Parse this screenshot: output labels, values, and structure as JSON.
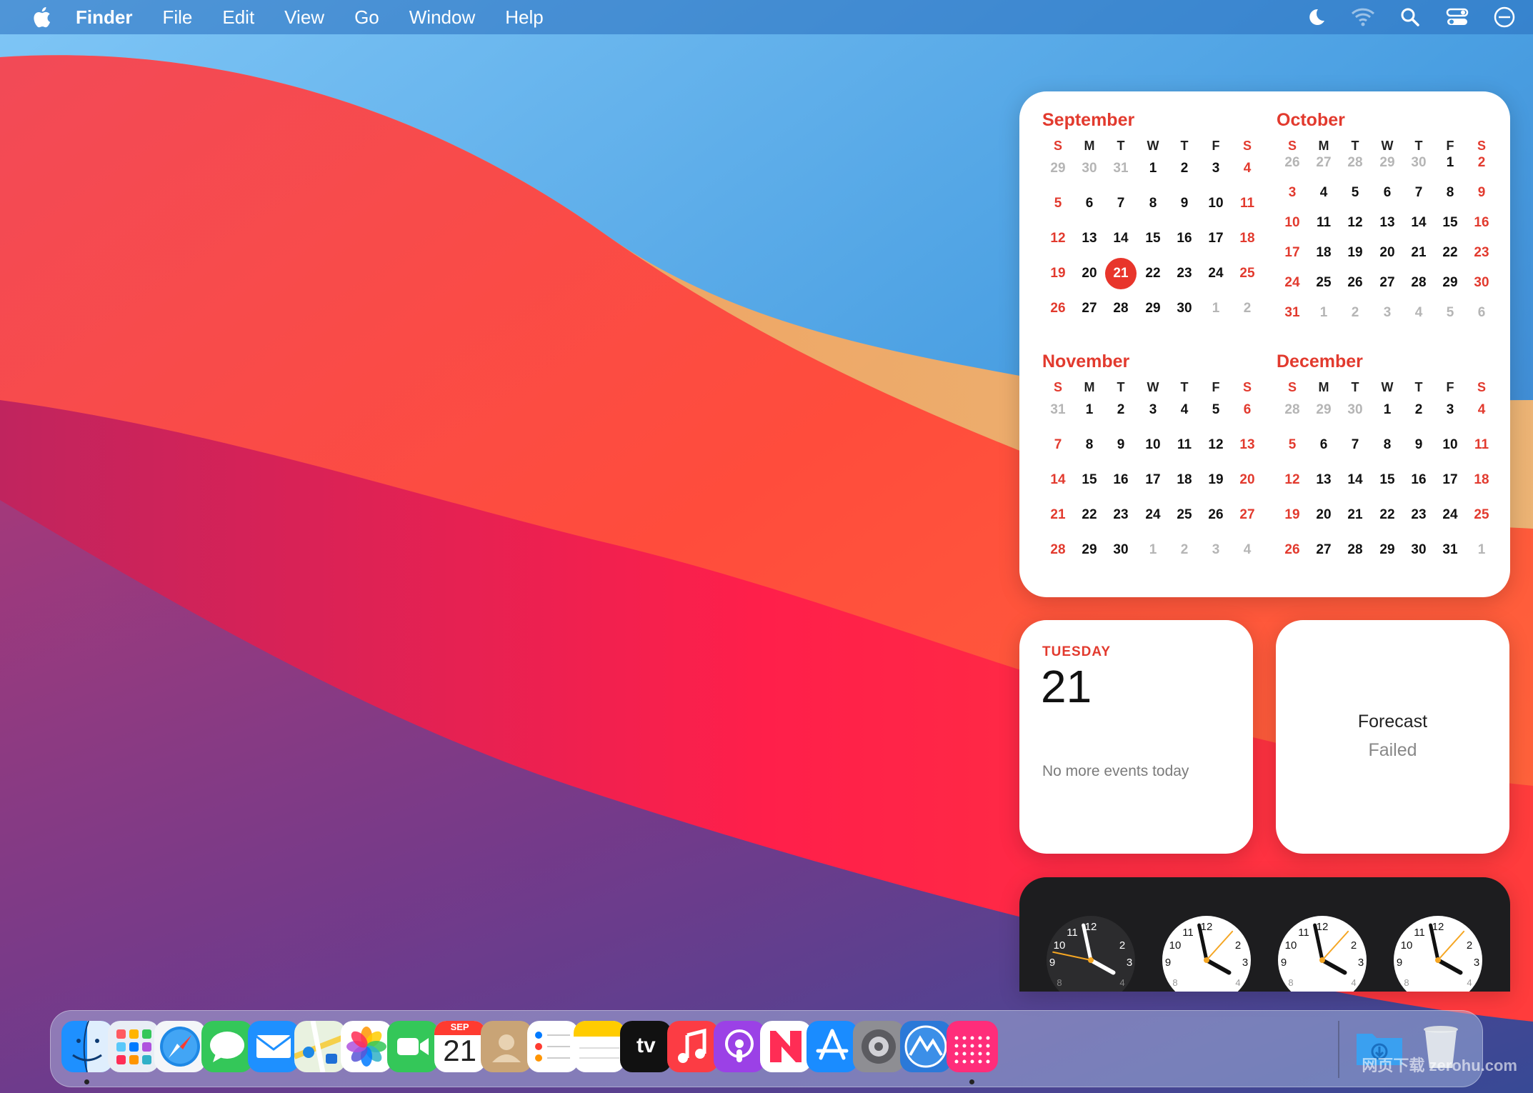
{
  "menubar": {
    "items": [
      {
        "label": "Finder",
        "bold": true
      },
      {
        "label": "File"
      },
      {
        "label": "Edit"
      },
      {
        "label": "View"
      },
      {
        "label": "Go"
      },
      {
        "label": "Window"
      },
      {
        "label": "Help"
      }
    ],
    "status_icons": [
      "moon-icon",
      "wifi-icon",
      "search-icon",
      "control-center-icon",
      "siri-icon"
    ]
  },
  "calendar": {
    "dow": [
      "S",
      "M",
      "T",
      "W",
      "T",
      "F",
      "S"
    ],
    "months": [
      {
        "name": "September",
        "weeks": [
          [
            29,
            30,
            31,
            1,
            2,
            3,
            4
          ],
          [
            5,
            6,
            7,
            8,
            9,
            10,
            11
          ],
          [
            12,
            13,
            14,
            15,
            16,
            17,
            18
          ],
          [
            19,
            20,
            21,
            22,
            23,
            24,
            25
          ],
          [
            26,
            27,
            28,
            29,
            30,
            1,
            2
          ]
        ],
        "leading": 3,
        "trailing": 2,
        "today": 21
      },
      {
        "name": "October",
        "weeks": [
          [
            26,
            27,
            28,
            29,
            30,
            1,
            2
          ],
          [
            3,
            4,
            5,
            6,
            7,
            8,
            9
          ],
          [
            10,
            11,
            12,
            13,
            14,
            15,
            16
          ],
          [
            17,
            18,
            19,
            20,
            21,
            22,
            23
          ],
          [
            24,
            25,
            26,
            27,
            28,
            29,
            30
          ],
          [
            31,
            1,
            2,
            3,
            4,
            5,
            6
          ]
        ],
        "leading": 5,
        "trailing": 6
      },
      {
        "name": "November",
        "weeks": [
          [
            31,
            1,
            2,
            3,
            4,
            5,
            6
          ],
          [
            7,
            8,
            9,
            10,
            11,
            12,
            13
          ],
          [
            14,
            15,
            16,
            17,
            18,
            19,
            20
          ],
          [
            21,
            22,
            23,
            24,
            25,
            26,
            27
          ],
          [
            28,
            29,
            30,
            1,
            2,
            3,
            4
          ]
        ],
        "leading": 1,
        "trailing": 4
      },
      {
        "name": "December",
        "weeks": [
          [
            28,
            29,
            30,
            1,
            2,
            3,
            4
          ],
          [
            5,
            6,
            7,
            8,
            9,
            10,
            11
          ],
          [
            12,
            13,
            14,
            15,
            16,
            17,
            18
          ],
          [
            19,
            20,
            21,
            22,
            23,
            24,
            25
          ],
          [
            26,
            27,
            28,
            29,
            30,
            31,
            1
          ]
        ],
        "leading": 3,
        "trailing": 1
      }
    ]
  },
  "events_widget": {
    "weekday": "TUESDAY",
    "day": "21",
    "message": "No more events today"
  },
  "weather_widget": {
    "line1": "Forecast",
    "line2": "Failed"
  },
  "clocks": [
    {
      "face": "dark",
      "hour": 3.0,
      "minute": 58,
      "second": 47
    },
    {
      "face": "light",
      "hour": 3.0,
      "minute": 58,
      "second": 7
    },
    {
      "face": "light",
      "hour": 3.0,
      "minute": 58,
      "second": 7
    },
    {
      "face": "light",
      "hour": 3.0,
      "minute": 58,
      "second": 7
    }
  ],
  "clock_numerals": [
    "12",
    "2",
    "10",
    "11",
    "9",
    "3",
    "8",
    "4"
  ],
  "dock": {
    "apps": [
      {
        "name": "finder",
        "running": true
      },
      {
        "name": "launchpad"
      },
      {
        "name": "safari"
      },
      {
        "name": "messages"
      },
      {
        "name": "mail"
      },
      {
        "name": "maps"
      },
      {
        "name": "photos"
      },
      {
        "name": "facetime"
      },
      {
        "name": "calendar",
        "month": "SEP",
        "day": "21"
      },
      {
        "name": "contacts"
      },
      {
        "name": "reminders"
      },
      {
        "name": "notes"
      },
      {
        "name": "apple-tv",
        "label": "tv"
      },
      {
        "name": "music"
      },
      {
        "name": "podcasts"
      },
      {
        "name": "news"
      },
      {
        "name": "app-store"
      },
      {
        "name": "system-preferences"
      },
      {
        "name": "monitor-app"
      },
      {
        "name": "grid-app",
        "running": true
      }
    ],
    "right": [
      {
        "name": "downloads-folder"
      },
      {
        "name": "trash"
      }
    ]
  },
  "watermark": "网页下载 zerohu.com",
  "colors": {
    "accent_red": "#e23a2e",
    "today_circle": "#e8352b"
  }
}
